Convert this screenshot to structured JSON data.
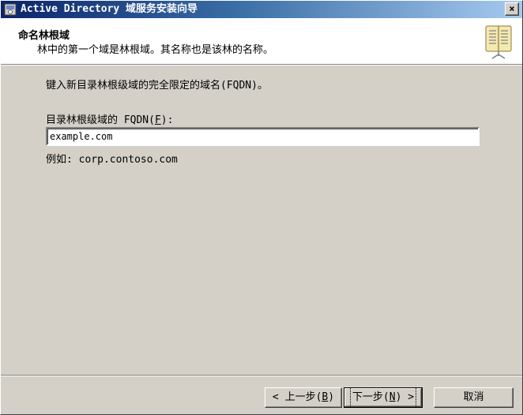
{
  "window": {
    "title": "Active Directory 域服务安装向导",
    "close_label": "×"
  },
  "header": {
    "title": "命名林根域",
    "subtitle": "林中的第一个域是林根域。其名称也是该林的名称。",
    "icon": "book-icon"
  },
  "main": {
    "instruction": "键入新目录林根级域的完全限定的域名(FQDN)。",
    "field_label_prefix": "目录林根级域的 FQDN(",
    "field_label_accel": "F",
    "field_label_suffix": "):",
    "fqdn_value": "example.com",
    "example_text": "例如: corp.contoso.com"
  },
  "buttons": {
    "back_prefix": "< 上一步(",
    "back_accel": "B",
    "back_suffix": ")",
    "next_prefix": "下一步(",
    "next_accel": "N",
    "next_suffix": ") >",
    "cancel": "取消"
  }
}
